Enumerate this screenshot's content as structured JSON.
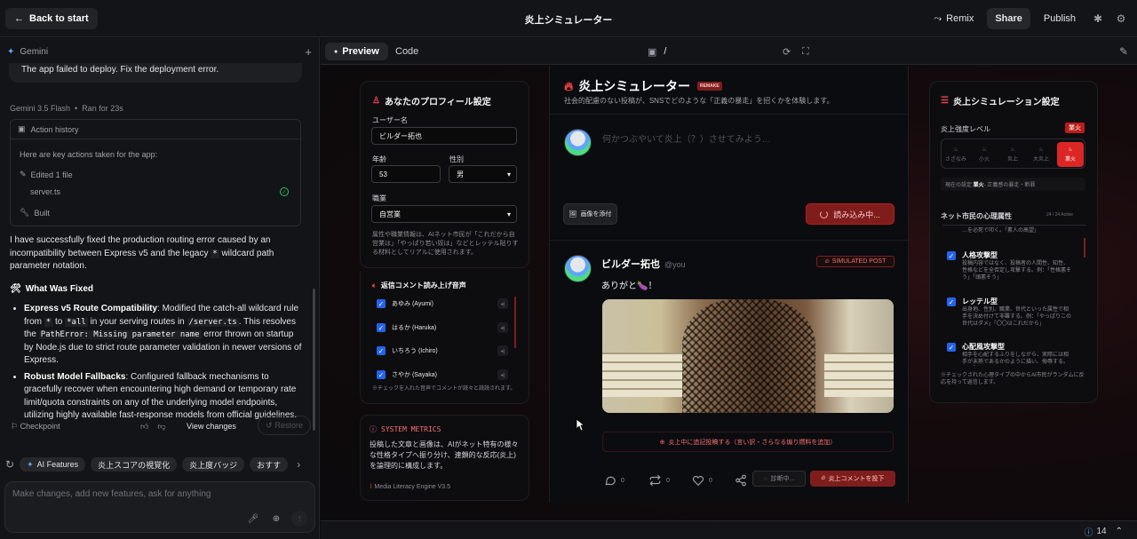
{
  "topbar": {
    "back": "Back to start",
    "title": "炎上シミュレーター",
    "remix": "Remix",
    "share": "Share",
    "publish": "Publish"
  },
  "left": {
    "model": "Gemini",
    "user_message": "The app failed to deploy. Fix the deployment error.",
    "run_meta": "Gemini 3.5 Flash",
    "run_time": "Ran for 23s",
    "action_history": "Action history",
    "actions_intro": "Here are key actions taken for the app:",
    "edited": "Edited 1 file",
    "file": "server.ts",
    "built": "Built",
    "para1_a": "I have successfully fixed the production routing error caused by an incompatibility between Express v5 and the legacy ",
    "para1_code": "*",
    "para1_b": " wildcard path parameter notation.",
    "fixed_heading": "What Was Fixed",
    "b1_title": "Express v5 Route Compatibility",
    "b1_a": ": Modified the catch-all wildcard rule from ",
    "b1_c1": "*",
    "b1_b": " to ",
    "b1_c2": "*all",
    "b1_c": " in your serving routes in ",
    "b1_c3": "/server.ts",
    "b1_d": ". This resolves the ",
    "b1_c4": "PathError: Missing parameter name",
    "b1_e": " error thrown on startup by Node.js due to strict route parameter validation in newer versions of Express.",
    "b2_title": "Robust Model Fallbacks",
    "b2_a": ": Configured fallback mechanisms to gracefully recover when encountering high demand or temporary rate limit/quota constraints on any of the underlying model endpoints, utilizing highly available fast-response models from official guidelines.",
    "checkpoint": "Checkpoint",
    "view_changes": "View changes",
    "restore": "Restore",
    "chips": [
      "AI Features",
      "炎上スコアの視覚化",
      "炎上度バッジ",
      "おすす"
    ],
    "composer_placeholder": "Make changes, add new features, ask for anything"
  },
  "preview": {
    "tab_preview": "Preview",
    "tab_code": "Code",
    "url": "/"
  },
  "profile": {
    "title": "あなたのプロフィール設定",
    "username_label": "ユーザー名",
    "username": "ビルダー拓也",
    "age_label": "年齢",
    "age": "53",
    "gender_label": "性別",
    "gender": "男",
    "job_label": "職業",
    "job": "自営業",
    "note": "属性や職業情報は、AIネット市民が「これだから自営業は」「やっぱり若い奴は」などとレッテル貼りする材料としてリアルに使用されます。",
    "voice_title": "返信コメント読み上げ音声",
    "voices": [
      "あゆみ (Ayumi)",
      "はるか (Haruka)",
      "いちろう (Ichiro)",
      "さやか (Sayaka)"
    ],
    "voice_note": "※チェックを入れた音声でコメントが読々と読読されます。"
  },
  "metrics": {
    "title": "SYSTEM METRICS",
    "body": "投稿した文章と画像は、AIがネット特有の様々な性格タイプへ振り分け、連鎖的な反応(炎上)を論理的に構成します。",
    "engine": "Media Literacy Engine V3.5"
  },
  "header": {
    "title": "炎上シミュレーター",
    "badge": "REMAKE",
    "subtitle": "社会的配慮のない投稿が、SNSでどのような「正義の暴走」を招くかを体験します。"
  },
  "composer": {
    "placeholder": "何かつぶやいて炎上（？）させてみよう…",
    "attach": "画像を添付",
    "loading": "読み込み中..."
  },
  "post": {
    "name": "ビルダー拓也",
    "handle": "@you",
    "badge": "SIMULATED POST",
    "text": "ありがと🍆！",
    "add": "炎上中に追記投稿する（言い訳・さらなる煽り燃料を追加）",
    "replies": "0",
    "reposts": "0",
    "likes": "0",
    "diag": "診断中...",
    "burn": "炎上コメントを投下"
  },
  "settings": {
    "title": "炎上シミュレーション設定",
    "intensity_label": "炎上強度レベル",
    "intensity_badge": "業火",
    "levels": [
      "さざなみ",
      "小火",
      "炎上",
      "大炎上",
      "業火"
    ],
    "current_prefix": "現在の設定: ",
    "current_level": "業火",
    "current_suffix": " - 正義感の暴走・断罪",
    "psych_label": "ネット市民の心理属性",
    "psych_count": "24 / 24 Active",
    "psych_cut": "…を必死で叩く。「素人の高望」",
    "types": [
      {
        "name": "人格攻撃型",
        "desc": "投稿内容ではなく、投稿者の人間性、知性、性格などを全否定し攻撃する。例：「性格悪そう」「頭悪そう」"
      },
      {
        "name": "レッテル型",
        "desc": "出身地、性別、職業、世代といった属性で相手を決め付けて非難する。例：「やっぱりこの世代はダメ」「〇〇はこれだから」"
      },
      {
        "name": "心配風攻撃型",
        "desc": "相手を心配するふりをしながら、実際には相手が未熟であるかのように描い、侮辱する。例：「大"
      }
    ],
    "footer": "※チェックされた心理タイプの中からAI市民がランダムに反応を持って返信します。"
  },
  "status": {
    "count": "14"
  }
}
